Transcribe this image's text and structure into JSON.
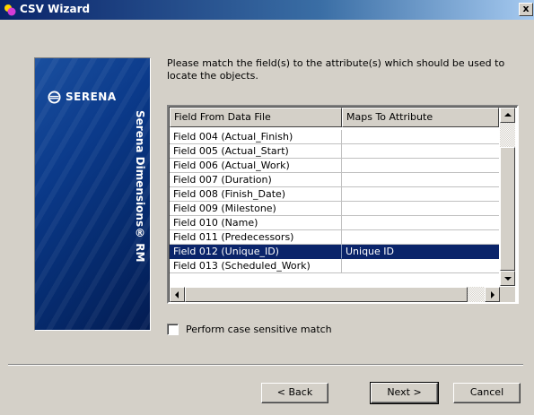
{
  "window": {
    "title": "CSV Wizard",
    "close_label": "x"
  },
  "banner": {
    "logo_text": "SERENA",
    "product_text": "Serena Dimensions® RM",
    "colors": {
      "dark": "#031c52",
      "mid": "#0b3a8a"
    }
  },
  "instruction": "Please match the field(s) to the attribute(s) which should be used to locate the objects.",
  "grid": {
    "headers": [
      "Field From Data File",
      "Maps To Attribute"
    ],
    "rows": [
      {
        "field": "Field 004 (Actual_Finish)",
        "attribute": ""
      },
      {
        "field": "Field 005 (Actual_Start)",
        "attribute": ""
      },
      {
        "field": "Field 006 (Actual_Work)",
        "attribute": ""
      },
      {
        "field": "Field 007 (Duration)",
        "attribute": ""
      },
      {
        "field": "Field 008 (Finish_Date)",
        "attribute": ""
      },
      {
        "field": "Field 009 (Milestone)",
        "attribute": ""
      },
      {
        "field": "Field 010 (Name)",
        "attribute": ""
      },
      {
        "field": "Field 011 (Predecessors)",
        "attribute": ""
      },
      {
        "field": "Field 012 (Unique_ID)",
        "attribute": "Unique ID",
        "selected": true
      },
      {
        "field": "Field 013 (Scheduled_Work)",
        "attribute": ""
      }
    ],
    "selection_color": "#0a246a"
  },
  "options": {
    "case_sensitive_label": "Perform case sensitive match",
    "case_sensitive_checked": false
  },
  "buttons": {
    "back": "< Back",
    "next": "Next >",
    "cancel": "Cancel"
  }
}
